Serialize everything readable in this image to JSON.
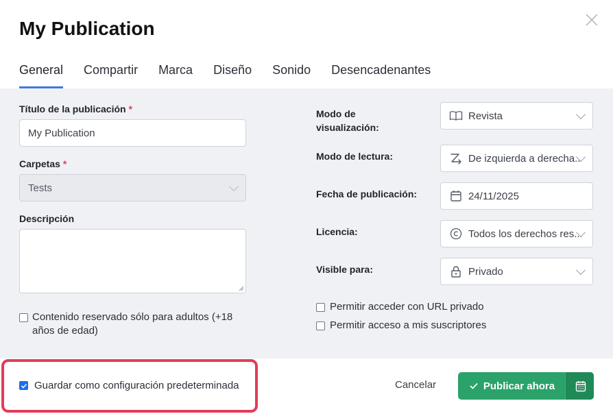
{
  "dialog": {
    "title": "My Publication"
  },
  "tabs": [
    {
      "label": "General",
      "active": true
    },
    {
      "label": "Compartir"
    },
    {
      "label": "Marca"
    },
    {
      "label": "Diseño"
    },
    {
      "label": "Sonido"
    },
    {
      "label": "Desencadenantes"
    }
  ],
  "left": {
    "title_label": "Título de la publicación",
    "title_value": "My Publication",
    "folders_label": "Carpetas",
    "folders_value": "Tests",
    "description_label": "Descripción",
    "description_value": "",
    "adult_label_line1": "Contenido reservado sólo para adultos (+18",
    "adult_label_line2": "años de edad)",
    "adult_checked": false,
    "required_mark": "*"
  },
  "right": {
    "view_mode_label_line1": "Modo de",
    "view_mode_label_line2": "visualización:",
    "view_mode_value": "Revista",
    "reading_mode_label": "Modo de lectura:",
    "reading_mode_value": "De izquierda a derecha...",
    "date_label": "Fecha de publicación:",
    "date_value": "24/11/2025",
    "license_label": "Licencia:",
    "license_value": "Todos los derechos res...",
    "visible_label": "Visible para:",
    "visible_value": "Privado",
    "private_url_label": "Permitir acceder con URL privado",
    "private_url_checked": false,
    "subscribers_label": "Permitir acceso a mis suscriptores",
    "subscribers_checked": false
  },
  "footer": {
    "save_default_label": "Guardar como configuración predeterminada",
    "save_default_checked": true,
    "cancel_label": "Cancelar",
    "publish_label": "Publicar ahora"
  },
  "colors": {
    "accent_tab": "#3d7ae0",
    "publish_green": "#2aa26a",
    "highlight_red": "#e23c58",
    "checkbox_blue": "#1e6fe6"
  },
  "icons": [
    "close-icon",
    "book-icon",
    "reading-direction-icon",
    "calendar-icon",
    "copyright-icon",
    "lock-icon",
    "check-icon",
    "schedule-calendar-icon"
  ]
}
